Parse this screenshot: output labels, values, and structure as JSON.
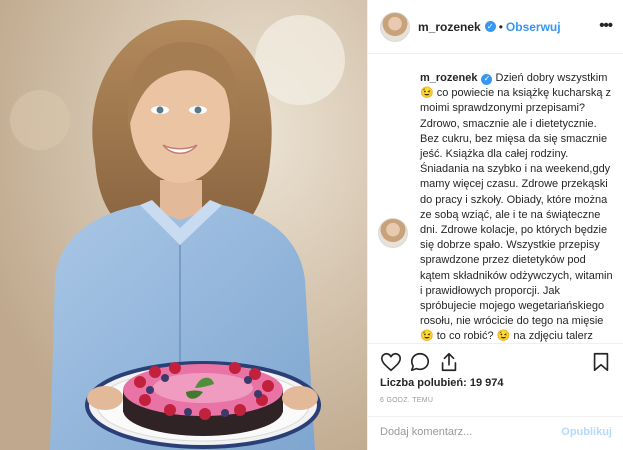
{
  "post": {
    "username": "m_rozenek",
    "follow_label": "Obserwuj",
    "separator": "•",
    "more_label": "•••",
    "caption_author": "m_rozenek",
    "caption_text": "Dzień dobry wszystkim 😉 co powiecie na książkę kucharską z moimi sprawdzonymi przepisami? Zdrowo, smacznie ale i dietetycznie. Bez cukru, bez mięsa da się smacznie jeść. Książka dla całej rodziny. Śniadania na szybko i na weekend,gdy mamy więcej czasu. Zdrowe przekąski do pracy i szkoły. Obiady, które można ze sobą wziąć, ale i te na świąteczne dni. Zdrowe kolacje, po których będzie się dobrze spało. Wszystkie przepisy sprawdzone przez dietetyków pod kątem składników odżywczych, witamin i prawidłowych proporcji. Jak spróbujecie mojego wegetariańskiego rosołu, nie wrócicie do tego na mięsie 😉 to co robić? 😉 na zdjęciu talerz serwisowy z mojej kolekcji porcelany Hampton do",
    "likes_label": "Liczba polubień:",
    "likes_count": "19 974",
    "time_label": "6 GODZ. TEMU",
    "comment_placeholder": "Dodaj komentarz...",
    "publish_label": "Opublikuj"
  },
  "icons": [
    "verified-badge-icon",
    "more-options-icon",
    "heart-icon",
    "comment-icon",
    "share-icon",
    "bookmark-icon"
  ],
  "colors": {
    "accent": "#3897f0",
    "publish_disabled": "#b3dbff",
    "text": "#262626",
    "muted": "#999999",
    "border": "#efefef"
  }
}
